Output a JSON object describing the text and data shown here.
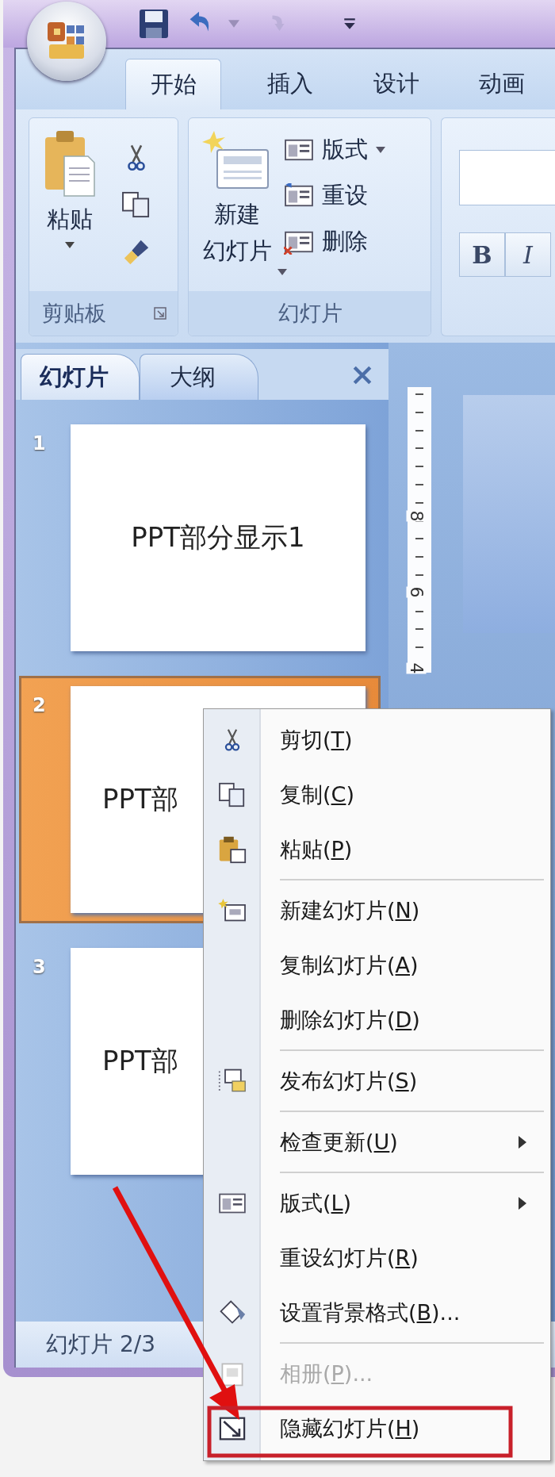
{
  "ribbon_tabs": [
    {
      "label": "开始",
      "selected": true
    },
    {
      "label": "插入",
      "selected": false
    },
    {
      "label": "设计",
      "selected": false
    },
    {
      "label": "动画",
      "selected": false
    }
  ],
  "clipboard_group": {
    "label": "剪贴板",
    "paste": "粘贴"
  },
  "slides_group": {
    "label": "幻灯片",
    "new_slide": [
      "新建",
      "幻灯片"
    ],
    "items": [
      "版式",
      "重设",
      "删除"
    ]
  },
  "font_group": {
    "buttons": [
      "B",
      "I"
    ]
  },
  "pane_tabs": [
    {
      "label": "幻灯片",
      "selected": true
    },
    {
      "label": "大纲",
      "selected": false
    }
  ],
  "slides": [
    {
      "number": "1",
      "title": "PPT部分显示1",
      "selected": false
    },
    {
      "number": "2",
      "title": "PPT部",
      "selected": true
    },
    {
      "number": "3",
      "title": "PPT部",
      "selected": false
    }
  ],
  "ruler": {
    "labels": [
      "8",
      "6",
      "4"
    ]
  },
  "status_bar": {
    "text": "幻灯片 2/3"
  },
  "context_menu": {
    "groups": [
      [
        {
          "label": "剪切(",
          "key": "T",
          "tail": ")",
          "disabled": false,
          "submenu": false
        },
        {
          "label": "复制(",
          "key": "C",
          "tail": ")",
          "disabled": false,
          "submenu": false
        },
        {
          "label": "粘贴(",
          "key": "P",
          "tail": ")",
          "disabled": false,
          "submenu": false
        }
      ],
      [
        {
          "label": "新建幻灯片(",
          "key": "N",
          "tail": ")",
          "disabled": false,
          "submenu": false
        },
        {
          "label": "复制幻灯片(",
          "key": "A",
          "tail": ")",
          "disabled": false,
          "submenu": false
        },
        {
          "label": "删除幻灯片(",
          "key": "D",
          "tail": ")",
          "disabled": false,
          "submenu": false
        }
      ],
      [
        {
          "label": "发布幻灯片(",
          "key": "S",
          "tail": ")",
          "disabled": false,
          "submenu": false
        }
      ],
      [
        {
          "label": "检查更新(",
          "key": "U",
          "tail": ")",
          "disabled": false,
          "submenu": true
        }
      ],
      [
        {
          "label": "版式(",
          "key": "L",
          "tail": ")",
          "disabled": false,
          "submenu": true
        },
        {
          "label": "重设幻灯片(",
          "key": "R",
          "tail": ")",
          "disabled": false,
          "submenu": false
        },
        {
          "label": "设置背景格式(",
          "key": "B",
          "tail": ")...",
          "disabled": false,
          "submenu": false
        }
      ],
      [
        {
          "label": "相册(",
          "key": "P",
          "tail": ")...",
          "disabled": true,
          "submenu": false
        },
        {
          "label": "隐藏幻灯片(",
          "key": "H",
          "tail": ")",
          "disabled": false,
          "submenu": false
        }
      ]
    ]
  }
}
